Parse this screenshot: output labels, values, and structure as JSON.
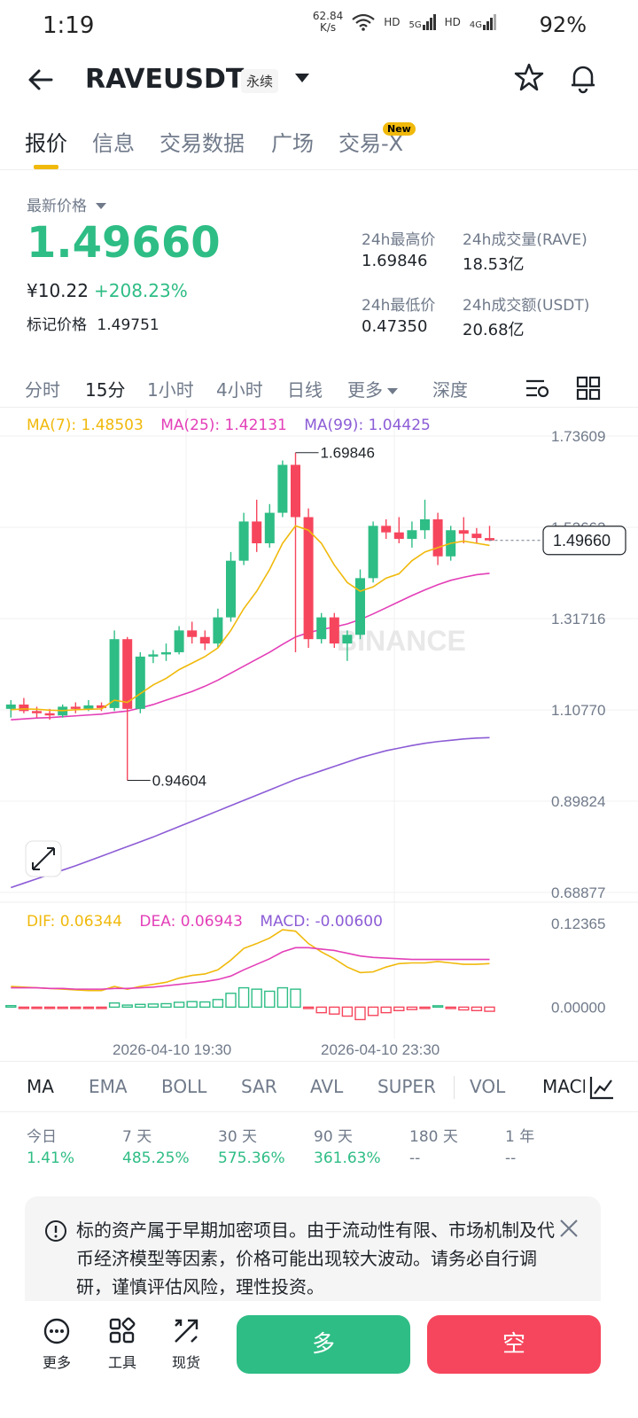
{
  "status": {
    "time": "1:19",
    "speed_value": "62.84",
    "speed_unit": "K/s",
    "hd1": "HD",
    "net1": "5G",
    "hd2": "HD",
    "net2": "4G",
    "battery": "92%"
  },
  "header": {
    "symbol": "RAVEUSDT",
    "contract_type": "永续"
  },
  "tabs": [
    "报价",
    "信息",
    "交易数据",
    "广场",
    "交易-X"
  ],
  "tab_badge": "New",
  "price": {
    "label": "最新价格",
    "last": "1.49660",
    "cny": "¥10.22",
    "change": "+208.23%",
    "mark_label": "标记价格",
    "mark_value": "1.49751"
  },
  "stats": {
    "high_label": "24h最高价",
    "high": "1.69846",
    "low_label": "24h最低价",
    "low": "0.47350",
    "vol_label": "24h成交量(RAVE)",
    "vol": "18.53亿",
    "turnover_label": "24h成交额(USDT)",
    "turnover": "20.68亿"
  },
  "intervals": [
    "分时",
    "15分",
    "1小时",
    "4小时",
    "日线",
    "更多",
    "深度"
  ],
  "ma_legend": {
    "ma7": "MA(7): 1.48503",
    "ma25": "MA(25): 1.42131",
    "ma99": "MA(99): 1.04425"
  },
  "macd_legend": {
    "dif": "DIF: 0.06344",
    "dea": "DEA: 0.06943",
    "macd": "MACD: -0.00600"
  },
  "chart": {
    "price_axis": [
      "1.73609",
      "1.52662",
      "1.31716",
      "1.10770",
      "0.89824",
      "0.68877"
    ],
    "last_price_tag": "1.49660",
    "high_marker": "1.69846",
    "low_marker": "0.94604",
    "macd_axis": [
      "0.12365",
      "0.00000"
    ],
    "time_labels": [
      "2026-04-10 19:30",
      "2026-04-10 23:30"
    ],
    "watermark": "BINANCE",
    "colors": {
      "up": "#2ebd85",
      "down": "#f6465d",
      "ma7": "#f0b90b",
      "ma25": "#e33fb8",
      "ma99": "#8c5cd6"
    }
  },
  "chart_data": {
    "type": "candlestick",
    "interval": "15分",
    "candles": [
      {
        "o": 1.11,
        "h": 1.13,
        "l": 1.09,
        "c": 1.12
      },
      {
        "o": 1.12,
        "h": 1.135,
        "l": 1.1,
        "c": 1.105
      },
      {
        "o": 1.105,
        "h": 1.115,
        "l": 1.09,
        "c": 1.1
      },
      {
        "o": 1.1,
        "h": 1.11,
        "l": 1.085,
        "c": 1.095
      },
      {
        "o": 1.095,
        "h": 1.12,
        "l": 1.09,
        "c": 1.115
      },
      {
        "o": 1.115,
        "h": 1.125,
        "l": 1.1,
        "c": 1.11
      },
      {
        "o": 1.11,
        "h": 1.13,
        "l": 1.105,
        "c": 1.118
      },
      {
        "o": 1.118,
        "h": 1.125,
        "l": 1.105,
        "c": 1.112
      },
      {
        "o": 1.112,
        "h": 1.29,
        "l": 1.105,
        "c": 1.27
      },
      {
        "o": 1.27,
        "h": 1.275,
        "l": 0.946,
        "c": 1.11
      },
      {
        "o": 1.11,
        "h": 1.24,
        "l": 1.1,
        "c": 1.23
      },
      {
        "o": 1.23,
        "h": 1.245,
        "l": 1.215,
        "c": 1.235
      },
      {
        "o": 1.235,
        "h": 1.26,
        "l": 1.22,
        "c": 1.24
      },
      {
        "o": 1.24,
        "h": 1.3,
        "l": 1.235,
        "c": 1.29
      },
      {
        "o": 1.29,
        "h": 1.31,
        "l": 1.26,
        "c": 1.275
      },
      {
        "o": 1.275,
        "h": 1.29,
        "l": 1.245,
        "c": 1.26
      },
      {
        "o": 1.26,
        "h": 1.34,
        "l": 1.25,
        "c": 1.32
      },
      {
        "o": 1.32,
        "h": 1.47,
        "l": 1.31,
        "c": 1.45
      },
      {
        "o": 1.45,
        "h": 1.56,
        "l": 1.44,
        "c": 1.54
      },
      {
        "o": 1.54,
        "h": 1.59,
        "l": 1.47,
        "c": 1.49
      },
      {
        "o": 1.49,
        "h": 1.58,
        "l": 1.48,
        "c": 1.56
      },
      {
        "o": 1.56,
        "h": 1.68,
        "l": 1.55,
        "c": 1.67
      },
      {
        "o": 1.67,
        "h": 1.698,
        "l": 1.24,
        "c": 1.55
      },
      {
        "o": 1.55,
        "h": 1.57,
        "l": 1.25,
        "c": 1.27
      },
      {
        "o": 1.27,
        "h": 1.33,
        "l": 1.26,
        "c": 1.32
      },
      {
        "o": 1.32,
        "h": 1.33,
        "l": 1.25,
        "c": 1.26
      },
      {
        "o": 1.26,
        "h": 1.29,
        "l": 1.22,
        "c": 1.28
      },
      {
        "o": 1.28,
        "h": 1.43,
        "l": 1.27,
        "c": 1.41
      },
      {
        "o": 1.41,
        "h": 1.54,
        "l": 1.4,
        "c": 1.53
      },
      {
        "o": 1.53,
        "h": 1.545,
        "l": 1.5,
        "c": 1.515
      },
      {
        "o": 1.515,
        "h": 1.55,
        "l": 1.49,
        "c": 1.5
      },
      {
        "o": 1.5,
        "h": 1.54,
        "l": 1.48,
        "c": 1.52
      },
      {
        "o": 1.52,
        "h": 1.59,
        "l": 1.5,
        "c": 1.545
      },
      {
        "o": 1.545,
        "h": 1.56,
        "l": 1.44,
        "c": 1.46
      },
      {
        "o": 1.46,
        "h": 1.53,
        "l": 1.45,
        "c": 1.52
      },
      {
        "o": 1.52,
        "h": 1.55,
        "l": 1.49,
        "c": 1.512
      },
      {
        "o": 1.512,
        "h": 1.525,
        "l": 1.49,
        "c": 1.502
      },
      {
        "o": 1.502,
        "h": 1.53,
        "l": 1.495,
        "c": 1.4966
      }
    ],
    "ma7": [
      1.108,
      1.11,
      1.109,
      1.107,
      1.106,
      1.108,
      1.109,
      1.11,
      1.13,
      1.125,
      1.145,
      1.165,
      1.18,
      1.2,
      1.215,
      1.23,
      1.25,
      1.29,
      1.34,
      1.38,
      1.43,
      1.49,
      1.53,
      1.52,
      1.49,
      1.44,
      1.4,
      1.38,
      1.39,
      1.41,
      1.42,
      1.45,
      1.47,
      1.48,
      1.49,
      1.495,
      1.49,
      1.485
    ],
    "ma25": [
      1.085,
      1.087,
      1.089,
      1.09,
      1.092,
      1.094,
      1.096,
      1.098,
      1.102,
      1.105,
      1.112,
      1.12,
      1.13,
      1.14,
      1.15,
      1.162,
      1.176,
      1.192,
      1.208,
      1.224,
      1.24,
      1.258,
      1.275,
      1.285,
      1.292,
      1.298,
      1.305,
      1.315,
      1.328,
      1.342,
      1.356,
      1.37,
      1.383,
      1.395,
      1.405,
      1.412,
      1.418,
      1.421
    ],
    "ma99": [
      0.7,
      0.71,
      0.72,
      0.73,
      0.74,
      0.75,
      0.761,
      0.772,
      0.783,
      0.794,
      0.805,
      0.816,
      0.828,
      0.84,
      0.852,
      0.864,
      0.876,
      0.888,
      0.9,
      0.912,
      0.924,
      0.936,
      0.948,
      0.958,
      0.968,
      0.978,
      0.988,
      0.998,
      1.006,
      1.014,
      1.02,
      1.026,
      1.031,
      1.035,
      1.038,
      1.041,
      1.043,
      1.044
    ],
    "macd_hist": [
      0.0022,
      -0.001,
      -0.0012,
      -0.0015,
      -0.0012,
      -0.001,
      -0.0008,
      -0.0005,
      0.006,
      0.003,
      0.004,
      0.0045,
      0.005,
      0.007,
      0.008,
      0.0075,
      0.011,
      0.02,
      0.028,
      0.026,
      0.023,
      0.028,
      0.026,
      -0.002,
      -0.008,
      -0.01,
      -0.013,
      -0.018,
      -0.012,
      -0.008,
      -0.005,
      -0.0035,
      -0.002,
      0.002,
      -0.002,
      -0.004,
      -0.005,
      -0.006
    ],
    "dif": [
      0.03,
      0.029,
      0.028,
      0.027,
      0.026,
      0.025,
      0.024,
      0.024,
      0.03,
      0.026,
      0.03,
      0.033,
      0.036,
      0.042,
      0.046,
      0.048,
      0.054,
      0.068,
      0.085,
      0.092,
      0.1,
      0.112,
      0.11,
      0.092,
      0.08,
      0.07,
      0.058,
      0.05,
      0.051,
      0.058,
      0.063,
      0.064,
      0.064,
      0.066,
      0.064,
      0.062,
      0.062,
      0.063
    ],
    "dea": [
      0.028,
      0.028,
      0.028,
      0.027,
      0.027,
      0.026,
      0.026,
      0.026,
      0.027,
      0.027,
      0.028,
      0.029,
      0.031,
      0.033,
      0.035,
      0.037,
      0.04,
      0.045,
      0.054,
      0.062,
      0.07,
      0.08,
      0.086,
      0.086,
      0.084,
      0.082,
      0.078,
      0.074,
      0.072,
      0.071,
      0.07,
      0.069,
      0.069,
      0.069,
      0.069,
      0.069,
      0.069,
      0.069
    ],
    "ylim": [
      0.68877,
      1.73609
    ],
    "macd_ylim": [
      -0.02,
      0.12365
    ]
  },
  "indicators": [
    "MA",
    "EMA",
    "BOLL",
    "SAR",
    "AVL",
    "SUPER",
    "VOL",
    "MACD"
  ],
  "performance": [
    {
      "label": "今日",
      "value": "1.41%"
    },
    {
      "label": "7 天",
      "value": "485.25%"
    },
    {
      "label": "30 天",
      "value": "575.36%"
    },
    {
      "label": "90 天",
      "value": "361.63%"
    },
    {
      "label": "180 天",
      "value": "--"
    },
    {
      "label": "1 年",
      "value": "--"
    }
  ],
  "notice": "标的资产属于早期加密项目。由于流动性有限、市场机制及代币经济模型等因素，价格可能出现较大波动。请务必自行调研，谨慎评估风险，理性投资。",
  "bottom": {
    "more": "更多",
    "tools": "工具",
    "spot": "现货",
    "long": "多",
    "short": "空"
  }
}
